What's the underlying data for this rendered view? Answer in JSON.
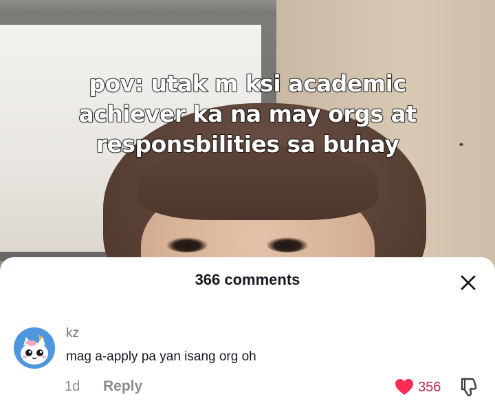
{
  "video": {
    "caption": "pov: utak m ksi academic\nachiever ka na may orgs at\nresponsbilities sa buhay"
  },
  "comments_sheet": {
    "title": "366 comments",
    "close_icon": "close-icon"
  },
  "comment": {
    "avatar_icon": "cat-unicorn-avatar",
    "username": "kz",
    "text": "mag a-apply pa yan isang org oh",
    "time": "1d",
    "reply_label": "Reply",
    "like_count": "356",
    "liked": true,
    "like_color": "#FE2C55"
  }
}
